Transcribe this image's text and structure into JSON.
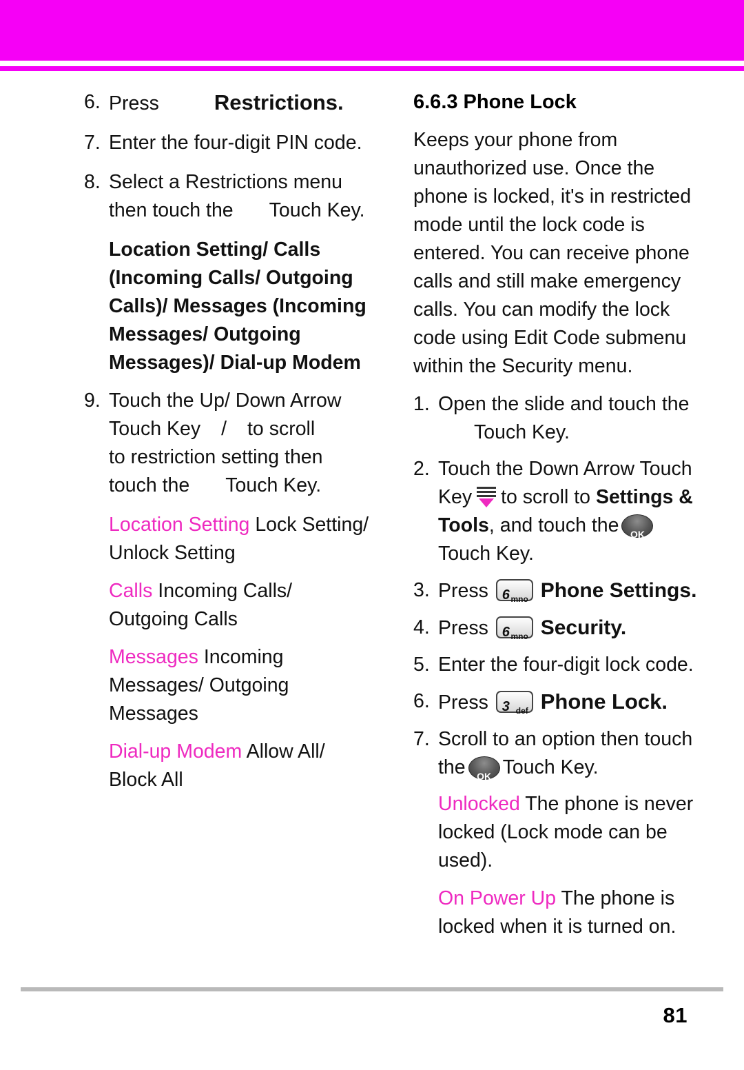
{
  "page": {
    "number": "81",
    "accent_color": "#f600f6",
    "link_color": "#ee2ac0"
  },
  "left_column": {
    "steps": [
      {
        "num": "6.",
        "text_before": "Press",
        "bold_text": "Restrictions",
        "text_after": "."
      },
      {
        "num": "7.",
        "text": "Enter the four-digit PIN code."
      },
      {
        "num": "8.",
        "line1": "Select a Restrictions menu",
        "line2_before": "then touch the",
        "line2_after": "Touch Key."
      },
      {
        "num": "9.",
        "line1": "Touch the Up/ Down Arrow",
        "line2_a": "Touch Key",
        "line2_slash": "/",
        "line2_b": "to scroll",
        "line3": "to restriction setting then",
        "line4_before": "touch the",
        "line4_after": "Touch Key."
      }
    ],
    "bold_block": [
      "Location Setting/ Calls",
      "(Incoming Calls/ Outgoing",
      "Calls)/ Messages (Incoming",
      "Messages/ Outgoing",
      "Messages)/ Dial-up Modem"
    ],
    "definitions": [
      {
        "term": "Location Setting",
        "desc": "Lock Setting/ Unlock Setting"
      },
      {
        "term": "Calls",
        "desc": "Incoming Calls/ Outgoing Calls"
      },
      {
        "term": "Messages",
        "desc": "Incoming Messages/ Outgoing Messages"
      },
      {
        "term": "Dial-up Modem",
        "desc": "Allow All/ Block All"
      }
    ]
  },
  "right_column": {
    "heading": "6.6.3 Phone Lock",
    "intro": "Keeps your phone from unauthorized use. Once the phone is locked, it's in restricted mode until the lock code is entered. You can receive phone calls and still make emergency calls. You can modify the lock code using Edit Code submenu within the Security menu.",
    "steps": [
      {
        "num": "1.",
        "line1": "Open the slide and touch the",
        "line2": "Touch Key."
      },
      {
        "num": "2.",
        "line1": "Touch the Down Arrow Touch",
        "key_label": "Key",
        "icon": "down-arrow-key-icon",
        "line2_a": "to scroll to",
        "bold_a": "Settings &",
        "bold_b": "Tools",
        "line3_a": ", and touch the",
        "ok_icon": "ok-key-icon",
        "line4": "Touch Key."
      },
      {
        "num": "3.",
        "press": "Press",
        "key_digit": "6",
        "key_letters": "mno",
        "bold": "Phone Settings",
        "after": "."
      },
      {
        "num": "4.",
        "press": "Press",
        "key_digit": "6",
        "key_letters": "mno",
        "bold": "Security",
        "after": "."
      },
      {
        "num": "5.",
        "text": "Enter the four-digit lock code."
      },
      {
        "num": "6.",
        "press": "Press",
        "key_digit": "3",
        "key_letters": "def",
        "bold": "Phone Lock",
        "after": "."
      },
      {
        "num": "7.",
        "line1": "Scroll to an option then touch",
        "line2_before": "the",
        "ok_icon": "ok-key-icon",
        "line2_after": "Touch Key."
      }
    ],
    "definitions": [
      {
        "term": "Unlocked",
        "desc": "The phone is never locked (Lock mode can be used)."
      },
      {
        "term": "On Power Up",
        "desc": "The phone is locked when it is turned on."
      }
    ]
  }
}
